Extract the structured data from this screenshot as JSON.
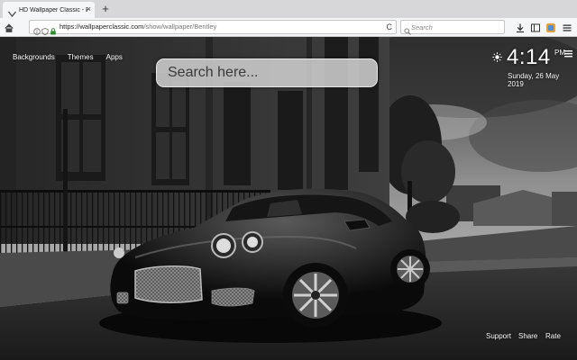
{
  "browser": {
    "tab_title": "HD Wallpaper Classic - Bentley",
    "tab_close": "×",
    "new_tab": "+",
    "url_domain": "https://wallpaperclassic.com",
    "url_path": "/show/wallpaper/Bentley",
    "reload": "C",
    "search_placeholder": "Search"
  },
  "page": {
    "nav": [
      "Backgrounds",
      "Themes",
      "Apps"
    ],
    "search_placeholder": "Search here...",
    "time": "4:14",
    "ampm": "PM",
    "date": "Sunday, 26 May 2019",
    "footer": [
      "Support",
      "Share",
      "Rate"
    ]
  }
}
